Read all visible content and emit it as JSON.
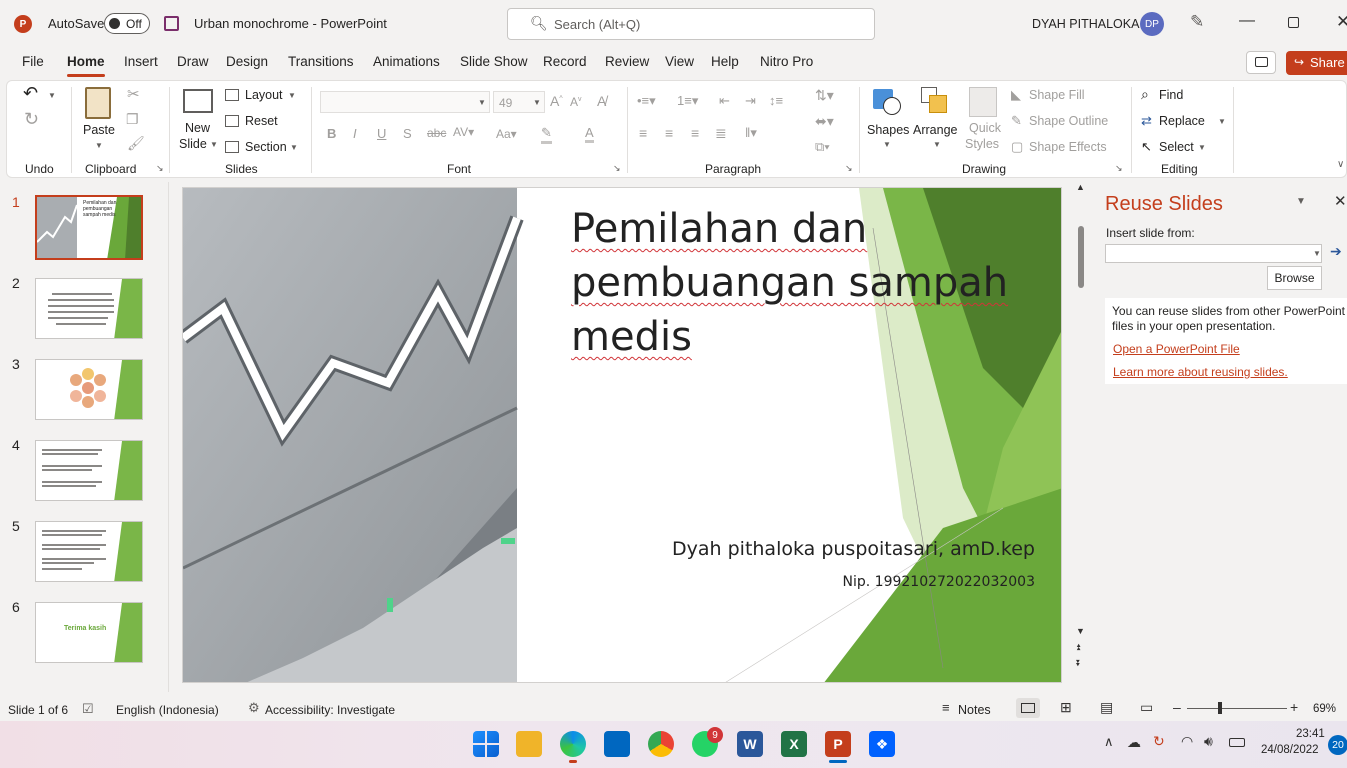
{
  "titlebar": {
    "autosave_label": "AutoSave",
    "autosave_state": "Off",
    "document_title": "Urban monochrome  -  PowerPoint",
    "search_placeholder": "Search (Alt+Q)",
    "user_name": "DYAH PITHALOKA",
    "user_initials": "DP"
  },
  "tabs": [
    "File",
    "Home",
    "Insert",
    "Draw",
    "Design",
    "Transitions",
    "Animations",
    "Slide Show",
    "Record",
    "Review",
    "View",
    "Help",
    "Nitro Pro"
  ],
  "active_tab": "Home",
  "share_label": "Share",
  "ribbon": {
    "undo_group": "Undo",
    "clipboard": {
      "label": "Clipboard",
      "paste": "Paste"
    },
    "slides": {
      "label": "Slides",
      "new_slide_1": "New",
      "new_slide_2": "Slide",
      "layout": "Layout",
      "reset": "Reset",
      "section": "Section"
    },
    "font": {
      "label": "Font",
      "font_size": "49"
    },
    "paragraph": {
      "label": "Paragraph"
    },
    "drawing": {
      "label": "Drawing",
      "shapes": "Shapes",
      "arrange": "Arrange",
      "quick_styles_1": "Quick",
      "quick_styles_2": "Styles",
      "shape_fill": "Shape Fill",
      "shape_outline": "Shape Outline",
      "shape_effects": "Shape Effects"
    },
    "editing": {
      "label": "Editing",
      "find": "Find",
      "replace": "Replace",
      "select": "Select"
    }
  },
  "thumbnails": {
    "numbers": [
      "1",
      "2",
      "3",
      "4",
      "5",
      "6"
    ],
    "t1_title": "Pemilahan dan pembuangan sampah medis",
    "t6_title": "Terima kasih"
  },
  "slide": {
    "title_line1": "Pemilahan dan",
    "title_line2": "pembuangan sampah",
    "title_line3": "medis",
    "author": "Dyah  pithaloka puspoitasari, amD.kep",
    "nip": "Nip. 199210272022032003"
  },
  "reuse_pane": {
    "title": "Reuse Slides",
    "insert_from": "Insert slide from:",
    "browse": "Browse",
    "info": "You can reuse slides from other PowerPoint files in your open presentation.",
    "link_open": "Open a PowerPoint File",
    "link_learn": "Learn more about reusing slides."
  },
  "status": {
    "slide_of": "Slide 1 of 6",
    "language": "English (Indonesia)",
    "accessibility": "Accessibility: Investigate",
    "notes": "Notes",
    "zoom": "69%"
  },
  "taskbar": {
    "whatsapp_badge": "9",
    "time": "23:41",
    "date": "24/08/2022",
    "notif_count": "20"
  },
  "colors": {
    "accent": "#c43e1c",
    "green": "#7ab648",
    "dark_green": "#4f7f2c"
  }
}
